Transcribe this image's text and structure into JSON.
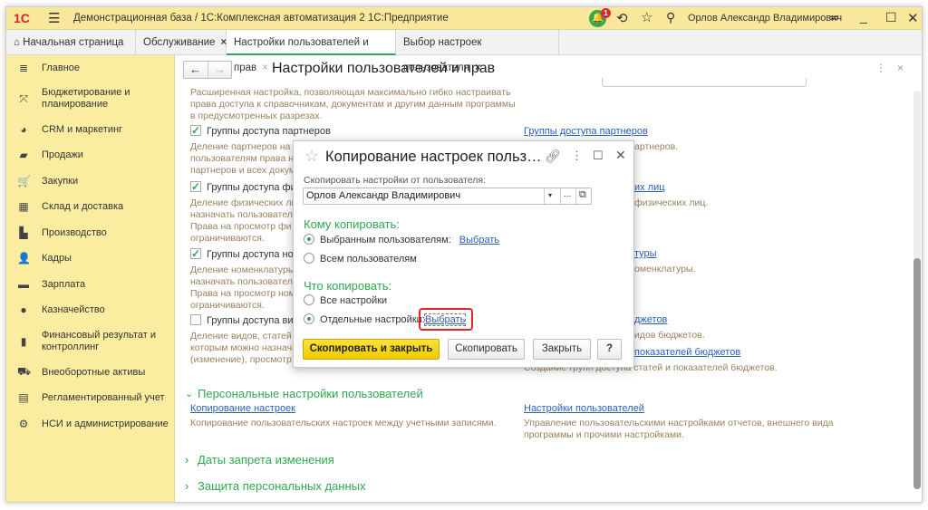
{
  "titlebar": {
    "logo": "1С",
    "title": "Демонстрационная база / 1С:Комплексная автоматизация 2 1С:Предприятие",
    "notifications": "1",
    "user": "Орлов Александр Владимирович"
  },
  "tabs": [
    {
      "label": "Начальная страница"
    },
    {
      "label": "Обслуживание",
      "close": "×"
    },
    {
      "label": "Настройки пользователей и прав",
      "close": "×"
    },
    {
      "label": "Выбор настроек пользователя",
      "close": "×"
    }
  ],
  "sidebar": {
    "items": [
      {
        "label": "Главное",
        "icon": "≣"
      },
      {
        "label": "Бюджетирование и",
        "label2": "планирование",
        "icon": "⤧"
      },
      {
        "label": "CRM и маркетинг",
        "icon": "◕"
      },
      {
        "label": "Продажи",
        "icon": "▰"
      },
      {
        "label": "Закупки",
        "icon": "🛒"
      },
      {
        "label": "Склад и доставка",
        "icon": "▦"
      },
      {
        "label": "Производство",
        "icon": "▙"
      },
      {
        "label": "Кадры",
        "icon": "👤"
      },
      {
        "label": "Зарплата",
        "icon": "▬"
      },
      {
        "label": "Казначейство",
        "icon": "●"
      },
      {
        "label": "Финансовый результат и",
        "label2": "контроллинг",
        "icon": "▮"
      },
      {
        "label": "Внеоборотные активы",
        "icon": "⛟"
      },
      {
        "label": "Регламентированный учет",
        "icon": "▤"
      },
      {
        "label": "НСИ и администрирование",
        "icon": "⚙"
      }
    ]
  },
  "page": {
    "title": "Настройки пользователей и прав",
    "intro": [
      "Расширенная настройка, позволяющая максимально гибко настраивать",
      "права доступа к справочникам, документам и другим данным программы",
      "в предусмотренных разрезах."
    ],
    "groups": [
      {
        "label": "Группы доступа партнеров",
        "checked": true,
        "desc": [
          "Деление партнеров на г",
          "пользователям права н",
          "партнеров и всех докум"
        ]
      },
      {
        "label": "Группы доступа фи",
        "checked": true,
        "desc": [
          "Деление физических ли",
          "назначать пользовател",
          "Права на просмотр фи",
          "ограничиваются."
        ]
      },
      {
        "label": "Группы доступа ном",
        "checked": true,
        "desc": [
          "Деление номенклатуры",
          "назначать пользовател",
          "Права на просмотр ном",
          "ограничиваются."
        ]
      },
      {
        "label": "Группы доступа вид",
        "checked": false,
        "desc": [
          "Деление видов, статей",
          "которым можно назнача",
          "(изменение), просмотр"
        ]
      }
    ],
    "right": {
      "link1": "Группы доступа партнеров",
      "desc1": "артнеров.",
      "link2": "их лиц",
      "desc2": "физических лиц.",
      "link3": "туры",
      "desc3": "оменклатуры.",
      "link4": "джетов",
      "desc4": "идов бюджетов.",
      "link5": "показателей бюджетов",
      "desc5": "Создание групп доступа статей и показателей бюджетов."
    },
    "personal": {
      "header": "Персональные настройки пользователей",
      "copy_link": "Копирование настроек",
      "copy_desc": "Копирование пользовательских настроек между учетными записями.",
      "settings_link": "Настройки пользователей",
      "settings_desc": [
        "Управление пользовательскими настройками отчетов, внешнего вида",
        "программы и прочими настройками."
      ]
    },
    "sections": [
      "Даты запрета изменения",
      "Защита персональных данных"
    ]
  },
  "dialog": {
    "title": "Копирование настроек польз…",
    "from_label": "Скопировать настройки от пользователя:",
    "from_value": "Орлов Александр Владимирович",
    "to_header": "Кому копировать:",
    "to_selected": "Выбранным пользователям:",
    "to_selected_link": "Выбрать",
    "to_all": "Всем пользователям",
    "to_choice": "selected",
    "what_header": "Что копировать:",
    "what_all": "Все настройки",
    "what_some": "Отдельные настройки:",
    "what_some_link": "Выбрать",
    "what_choice": "some",
    "btn_copy_close": "Скопировать и закрыть",
    "btn_copy": "Скопировать",
    "btn_close": "Закрыть",
    "btn_help": "?"
  },
  "colors": {
    "accent": "#2fa84f",
    "yellow": "#fbed9f",
    "primary_button": "#f5d30d",
    "highlight": "#e0262b",
    "link": "#2a5fb5"
  }
}
